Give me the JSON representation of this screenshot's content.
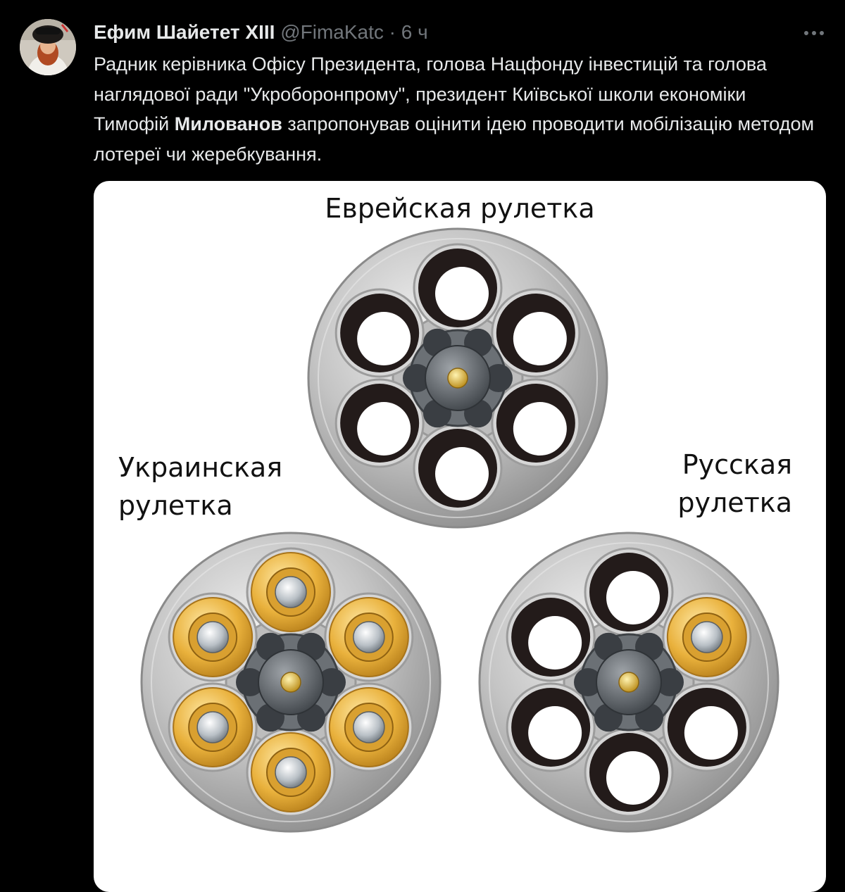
{
  "tweet": {
    "author_name": "Ефим Шайетет XIII",
    "handle": "@FimaKatc",
    "separator": "·",
    "time": "6 ч",
    "text_part1": "Радник керівника Офісу Президента, голова Нацфонду інвестицій та голова наглядової ради \"Укроборонпрому\", президент Київської школи економіки Тимофій ",
    "text_bold": "Милованов",
    "text_part2": " запропонував оцінити ідею проводити мобілізацію методом лотереї чи жеребкування."
  },
  "image": {
    "caption_top": "Еврейская рулетка",
    "caption_left_line1": "Украинская",
    "caption_left_line2": "рулетка",
    "caption_right_line1": "Русская",
    "caption_right_line2": "рулетка",
    "cylinders": [
      {
        "name": "jewish",
        "chambers": [
          "empty",
          "empty",
          "empty",
          "empty",
          "empty",
          "empty"
        ]
      },
      {
        "name": "ukrainian",
        "chambers": [
          "loaded",
          "loaded",
          "loaded",
          "loaded",
          "loaded",
          "loaded"
        ]
      },
      {
        "name": "russian",
        "chambers": [
          "empty",
          "loaded",
          "empty",
          "empty",
          "empty",
          "empty"
        ]
      }
    ]
  },
  "icons": {
    "more": "more-dots-icon",
    "avatar": "avatar"
  },
  "colors": {
    "background": "#000000",
    "text": "#e7e9ea",
    "muted": "#71767b",
    "brass": "#e0a52e"
  }
}
